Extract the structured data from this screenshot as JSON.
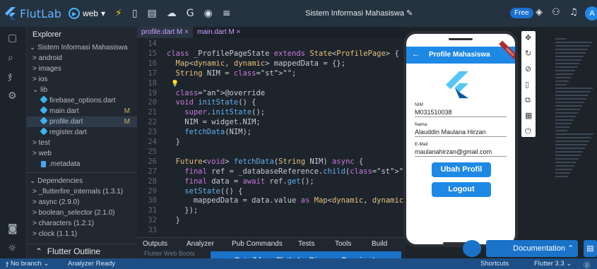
{
  "topbar": {
    "brand": "FlutLab",
    "platform": "web",
    "project_title": "Sistem Informasi Mahasiswa",
    "plan_badge": "Free",
    "avatar_letter": "A"
  },
  "explorer": {
    "title": "Explorer",
    "project": "Sistem Informasi Mahasiswa",
    "folders": [
      "android",
      "images",
      "ios"
    ],
    "lib_label": "lib",
    "lib_files": [
      {
        "name": "firebase_options.dart",
        "modified": ""
      },
      {
        "name": "main.dart",
        "modified": "M"
      },
      {
        "name": "profile.dart",
        "modified": "M"
      },
      {
        "name": "register.dart",
        "modified": ""
      }
    ],
    "folders_after": [
      "test",
      "web"
    ],
    "metadata_file": ".metadata",
    "dependencies_label": "Dependencies",
    "dependencies": [
      "_flutterfire_internals (1.3.1)",
      "async (2.9.0)",
      "boolean_selector (2.1.0)",
      "characters (1.2.1)",
      "clock (1.1.1)"
    ],
    "outline_label": "Flutter Outline"
  },
  "editor": {
    "tabs": [
      {
        "label": "profile.dart M ×"
      },
      {
        "label": "main.dart M ×"
      }
    ],
    "lines": [
      {
        "n": "14",
        "code": ""
      },
      {
        "n": "15",
        "code": "class _ProfilePageState extends State<ProfilePage> {"
      },
      {
        "n": "16",
        "code": "  Map<dynamic, dynamic> mappedData = {};"
      },
      {
        "n": "17",
        "code": "  String NIM = \"\";"
      },
      {
        "n": "18",
        "code": ""
      },
      {
        "n": "19",
        "code": "  @override"
      },
      {
        "n": "20",
        "code": "  void initState() {"
      },
      {
        "n": "21",
        "code": "    super.initState();"
      },
      {
        "n": "22",
        "code": "    NIM = widget.NIM;"
      },
      {
        "n": "23",
        "code": "    fetchData(NIM);"
      },
      {
        "n": "24",
        "code": "  }"
      },
      {
        "n": "25",
        "code": ""
      },
      {
        "n": "26",
        "code": "  Future<void> fetchData(String NIM) async {"
      },
      {
        "n": "27",
        "code": "    final ref = _databaseReference.child(\"Mahasiswa\").ch"
      },
      {
        "n": "28",
        "code": "    final data = await ref.get();"
      },
      {
        "n": "29",
        "code": "    setState(() {"
      },
      {
        "n": "30",
        "code": "      mappedData = data.value as Map<dynamic, dynamic>;"
      },
      {
        "n": "31",
        "code": "    });"
      },
      {
        "n": "32",
        "code": "  }"
      },
      {
        "n": "33",
        "code": ""
      }
    ]
  },
  "bottom_panel": {
    "tabs": [
      "Outputs",
      "Analyzer",
      "Pub Commands",
      "Tests",
      "Tools",
      "Build"
    ],
    "footer_text": "Flutter Web Boots"
  },
  "premium_banner": "Get all from FlutLab - Discover Premium!",
  "phone": {
    "appbar_title": "Profile Mahasiswa",
    "debug_ribbon": "DEBUG",
    "fields": [
      {
        "label": "NIM",
        "value": "M031510038"
      },
      {
        "label": "Nama",
        "value": "Alauddin Maulana Hirzan"
      },
      {
        "label": "E-Mail",
        "value": "maulanahirzan@gmail.com"
      }
    ],
    "buttons": [
      "Ubah Profil",
      "Logout"
    ]
  },
  "documentation_button": "Documentation",
  "status": {
    "branch": "No branch",
    "analyzer": "Analyzer Ready",
    "shortcuts": "Shortcuts",
    "flutter_version": "Flutter 3.3"
  },
  "colors": {
    "accent": "#1e88e5",
    "topbar": "#253240",
    "status": "#1d4f86"
  }
}
